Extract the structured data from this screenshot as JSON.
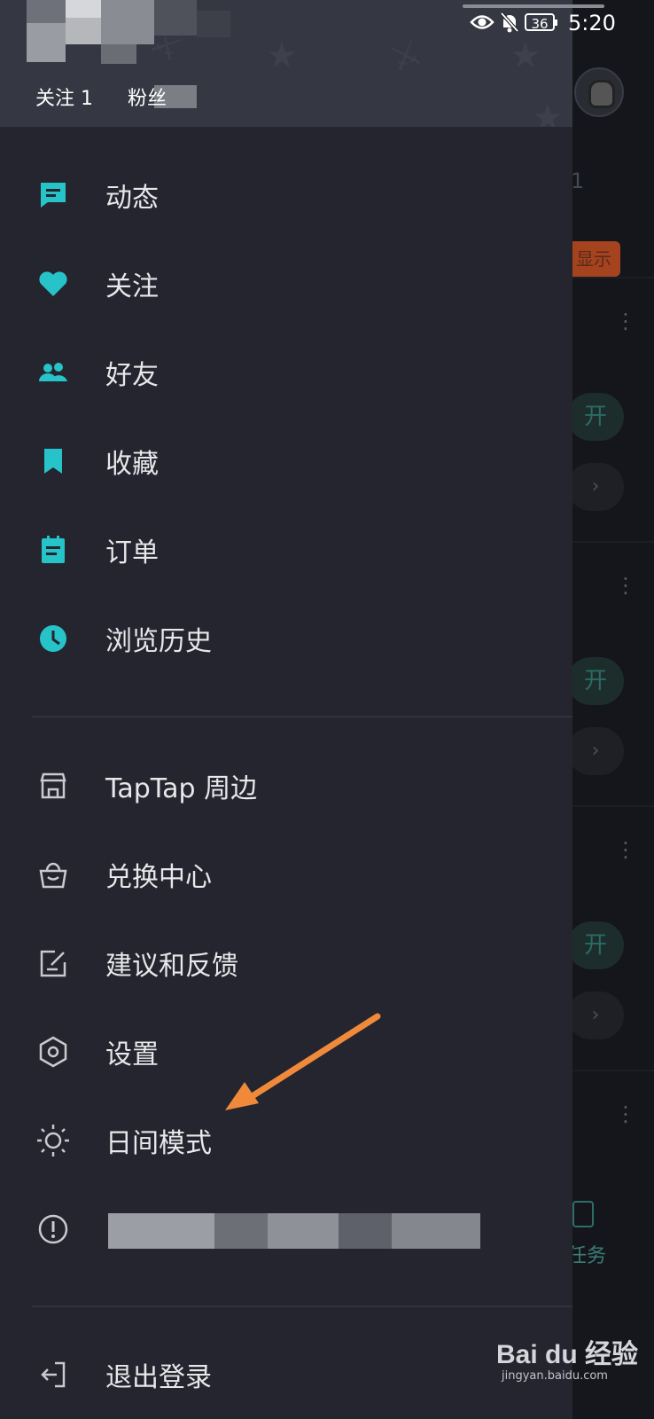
{
  "status_bar": {
    "time": "5:20",
    "battery": "36"
  },
  "header": {
    "follow_label": "关注 1",
    "fans_label": "粉丝"
  },
  "background": {
    "count": "1",
    "show_button": "显示",
    "pill_label": "开",
    "task_label": "任务"
  },
  "menu_primary": [
    {
      "label": "动态",
      "icon": "message-icon"
    },
    {
      "label": "关注",
      "icon": "heart-icon"
    },
    {
      "label": "好友",
      "icon": "friends-icon"
    },
    {
      "label": "收藏",
      "icon": "bookmark-icon"
    },
    {
      "label": "订单",
      "icon": "order-icon"
    },
    {
      "label": "浏览历史",
      "icon": "clock-icon"
    }
  ],
  "menu_secondary": [
    {
      "label": "TapTap 周边",
      "icon": "store-icon"
    },
    {
      "label": "兑换中心",
      "icon": "bag-icon"
    },
    {
      "label": "建议和反馈",
      "icon": "edit-icon"
    },
    {
      "label": "设置",
      "icon": "hexagon-gear-icon"
    },
    {
      "label": "日间模式",
      "icon": "sun-icon"
    },
    {
      "label": "",
      "icon": "info-icon"
    }
  ],
  "logout": {
    "label": "退出登录",
    "icon": "logout-icon"
  },
  "colors": {
    "accent": "#26c4c8",
    "drawer_bg": "#24252f",
    "header_bg": "#353742",
    "arrow": "#f08a3a"
  },
  "watermark": {
    "brand": "Bai du 经验",
    "url": "jingyan.baidu.com"
  }
}
